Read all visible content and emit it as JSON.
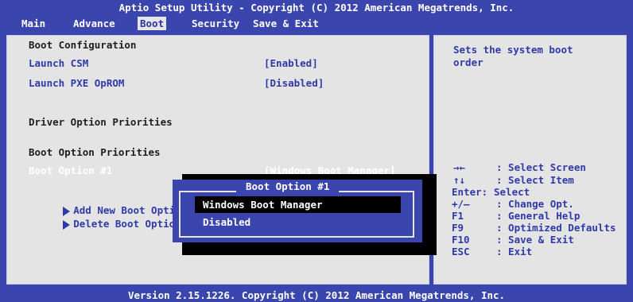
{
  "header": {
    "title": "Aptio Setup Utility - Copyright (C) 2012 American Megatrends, Inc.",
    "tabs": [
      {
        "label": "Main"
      },
      {
        "label": "Advance"
      },
      {
        "label": "Boot"
      },
      {
        "label": "Security"
      },
      {
        "label": "Save & Exit"
      }
    ],
    "active_tab": "Boot"
  },
  "left": {
    "section_boot_config": "Boot Configuration",
    "launch_csm_label": "Launch CSM",
    "launch_csm_value": "[Enabled]",
    "launch_pxe_label": "Launch PXE OpROM",
    "launch_pxe_value": "[Disabled]",
    "driver_priorities": "Driver Option Priorities",
    "boot_priorities": "Boot Option Priorities",
    "boot_option1_label": "Boot Option #1",
    "boot_option1_value": "[Windows Boot Manager]",
    "add_new_boot": "Add New Boot Option",
    "delete_boot": "Delete Boot Option"
  },
  "help": {
    "description_line1": "Sets the system boot",
    "description_line2": "order",
    "keys": [
      {
        "key": "→←",
        "desc": ": Select Screen"
      },
      {
        "key": "↑↓",
        "desc": ": Select Item"
      },
      {
        "key": "Enter:",
        "desc": "Select"
      },
      {
        "key": "+/—",
        "desc": ": Change Opt."
      },
      {
        "key": "F1",
        "desc": ": General Help"
      },
      {
        "key": "F9",
        "desc": ": Optimized Defaults"
      },
      {
        "key": "F10",
        "desc": ": Save & Exit"
      },
      {
        "key": "ESC",
        "desc": ": Exit"
      }
    ]
  },
  "popup": {
    "title": "Boot Option #1",
    "options": [
      "Windows Boot Manager",
      "Disabled"
    ],
    "selected": "Windows Boot Manager"
  },
  "footer": {
    "version": "Version 2.15.1226. Copyright (C) 2012 American Megatrends, Inc."
  },
  "colors": {
    "bios_blue": "#3a46ad",
    "panel_gray": "#e4e4e4",
    "highlight_black": "#000000"
  }
}
